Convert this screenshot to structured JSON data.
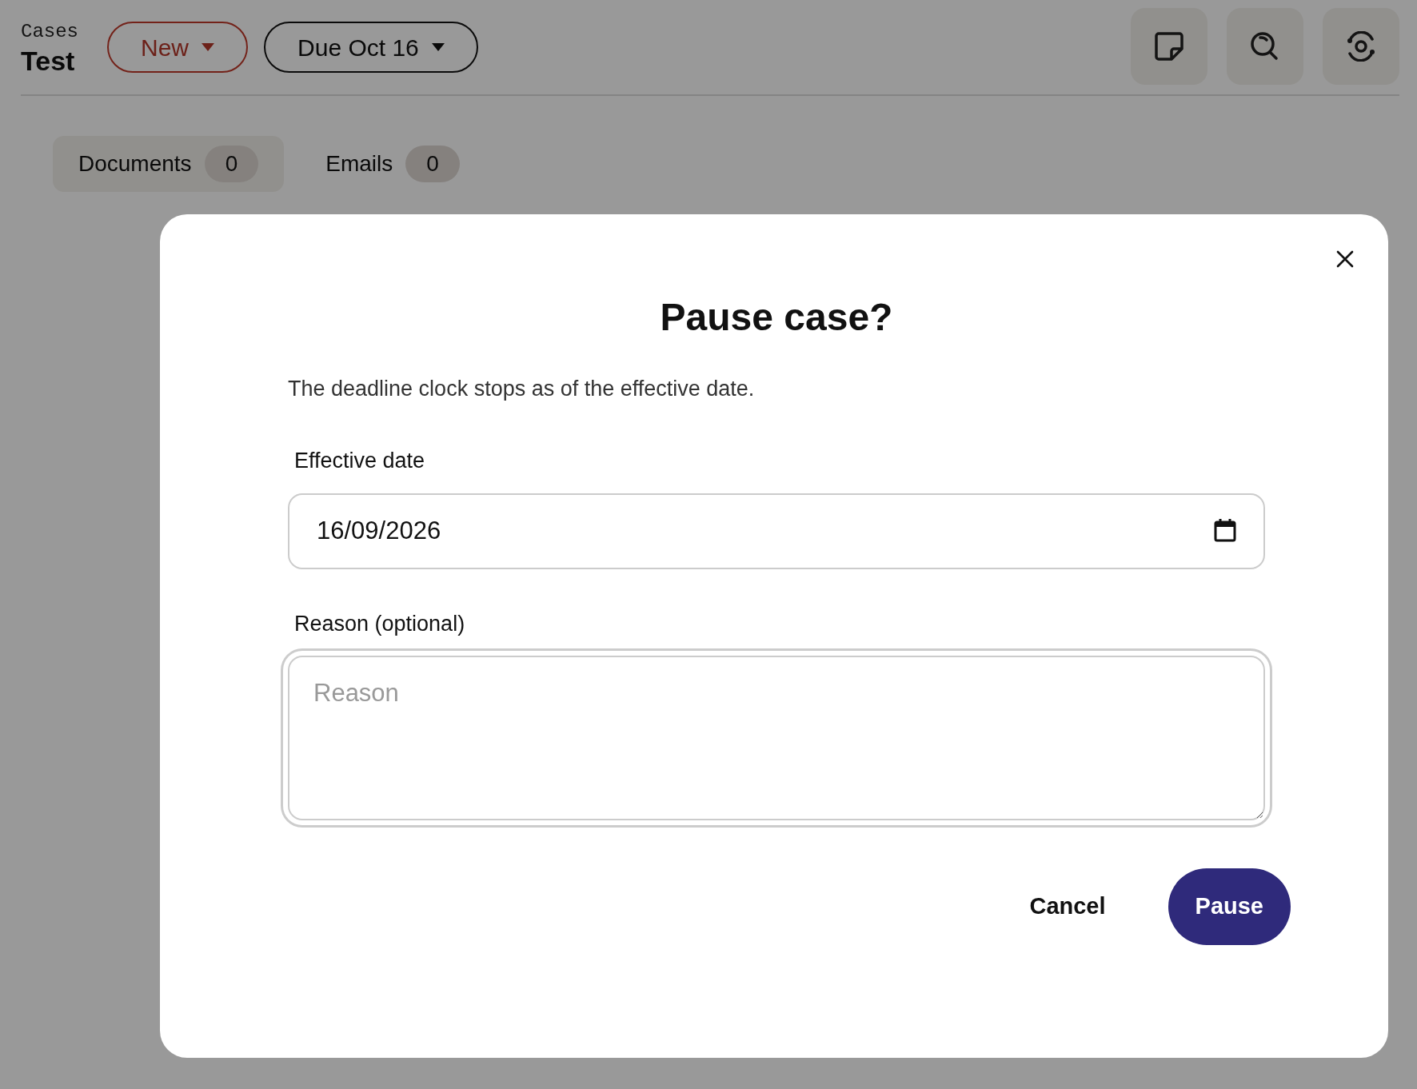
{
  "header": {
    "breadcrumb": "Cases",
    "title": "Test",
    "status_button": {
      "label": "New"
    },
    "due_button": {
      "label": "Due Oct 16"
    }
  },
  "tabs": [
    {
      "label": "Documents",
      "count": "0",
      "selected": true
    },
    {
      "label": "Emails",
      "count": "0",
      "selected": false
    }
  ],
  "dialog": {
    "title": "Pause case?",
    "description": "The deadline clock stops as of the effective date.",
    "fields": [
      {
        "kind": "date",
        "label": "Effective date",
        "value": "16/09/2026",
        "focused": false
      },
      {
        "kind": "textarea",
        "label": "Reason (optional)",
        "placeholder": "Reason",
        "focused": true
      }
    ],
    "buttons": [
      {
        "kind": "secondary",
        "label": "Cancel"
      },
      {
        "kind": "primary",
        "label": "Pause"
      }
    ]
  }
}
